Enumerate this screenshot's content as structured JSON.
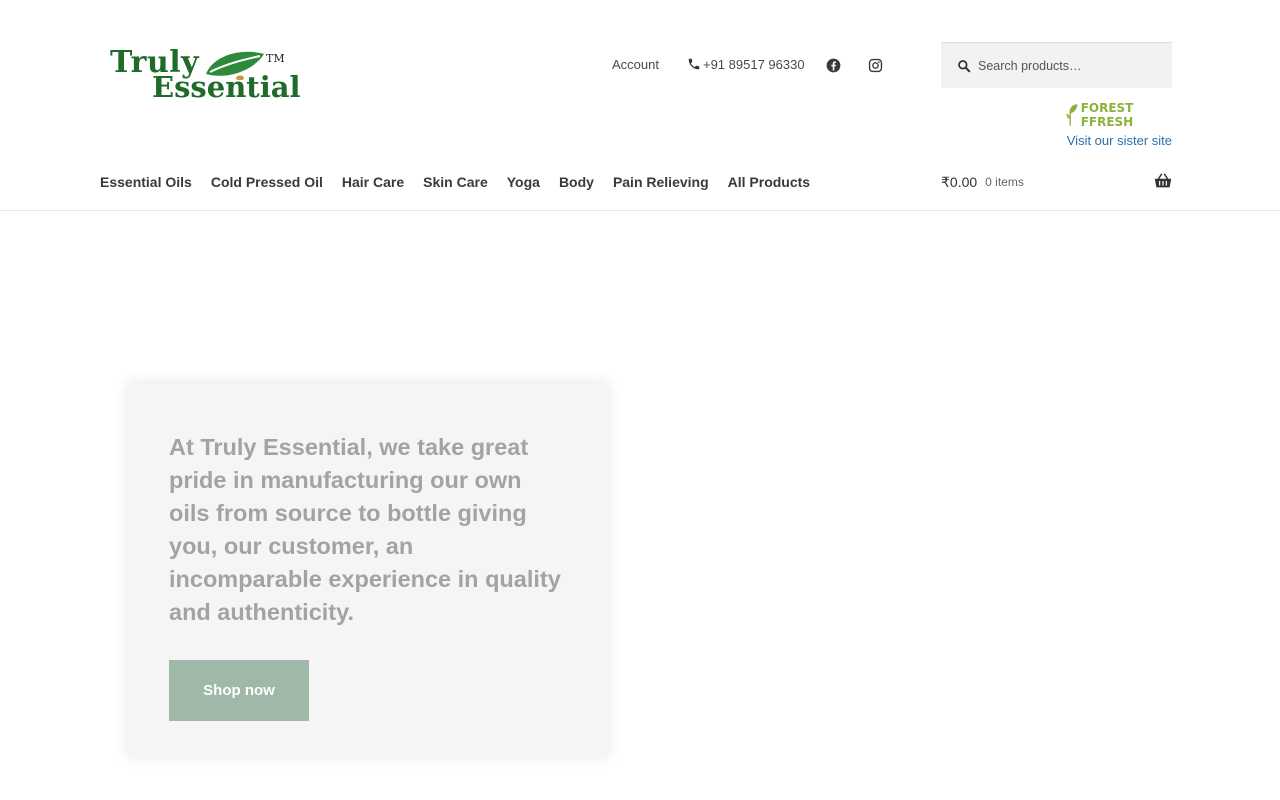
{
  "brand": {
    "logo_line1": "Truly",
    "logo_line2": "Essential",
    "logo_tm": "TM"
  },
  "top_links": {
    "account": "Account",
    "phone": "+91 89517 96330"
  },
  "social_icons": [
    "facebook-icon",
    "instagram-icon"
  ],
  "search": {
    "placeholder": "Search products…"
  },
  "sister_site": {
    "logo_text": "FOREST FFRESH",
    "link": "Visit our sister site"
  },
  "nav": {
    "items": [
      {
        "label": "Essential Oils"
      },
      {
        "label": "Cold Pressed Oil"
      },
      {
        "label": "Hair Care"
      },
      {
        "label": "Skin Care"
      },
      {
        "label": "Yoga"
      },
      {
        "label": "Body"
      },
      {
        "label": "Pain Relieving"
      },
      {
        "label": "All Products"
      }
    ]
  },
  "cart": {
    "total": "₹0.00",
    "count": "0 items"
  },
  "hero": {
    "text": "At Truly Essential, we take great pride in manufacturing our own oils from source to bottle giving you, our customer, an incomparable experience in quality and authenticity.",
    "button": "Shop now"
  },
  "colors": {
    "brand_green": "#1e6b2a",
    "link_blue": "#2f6ea8",
    "button_bg": "#a0b8a8",
    "hero_text": "#a3a3a3",
    "card_bg": "#f5f5f5"
  }
}
